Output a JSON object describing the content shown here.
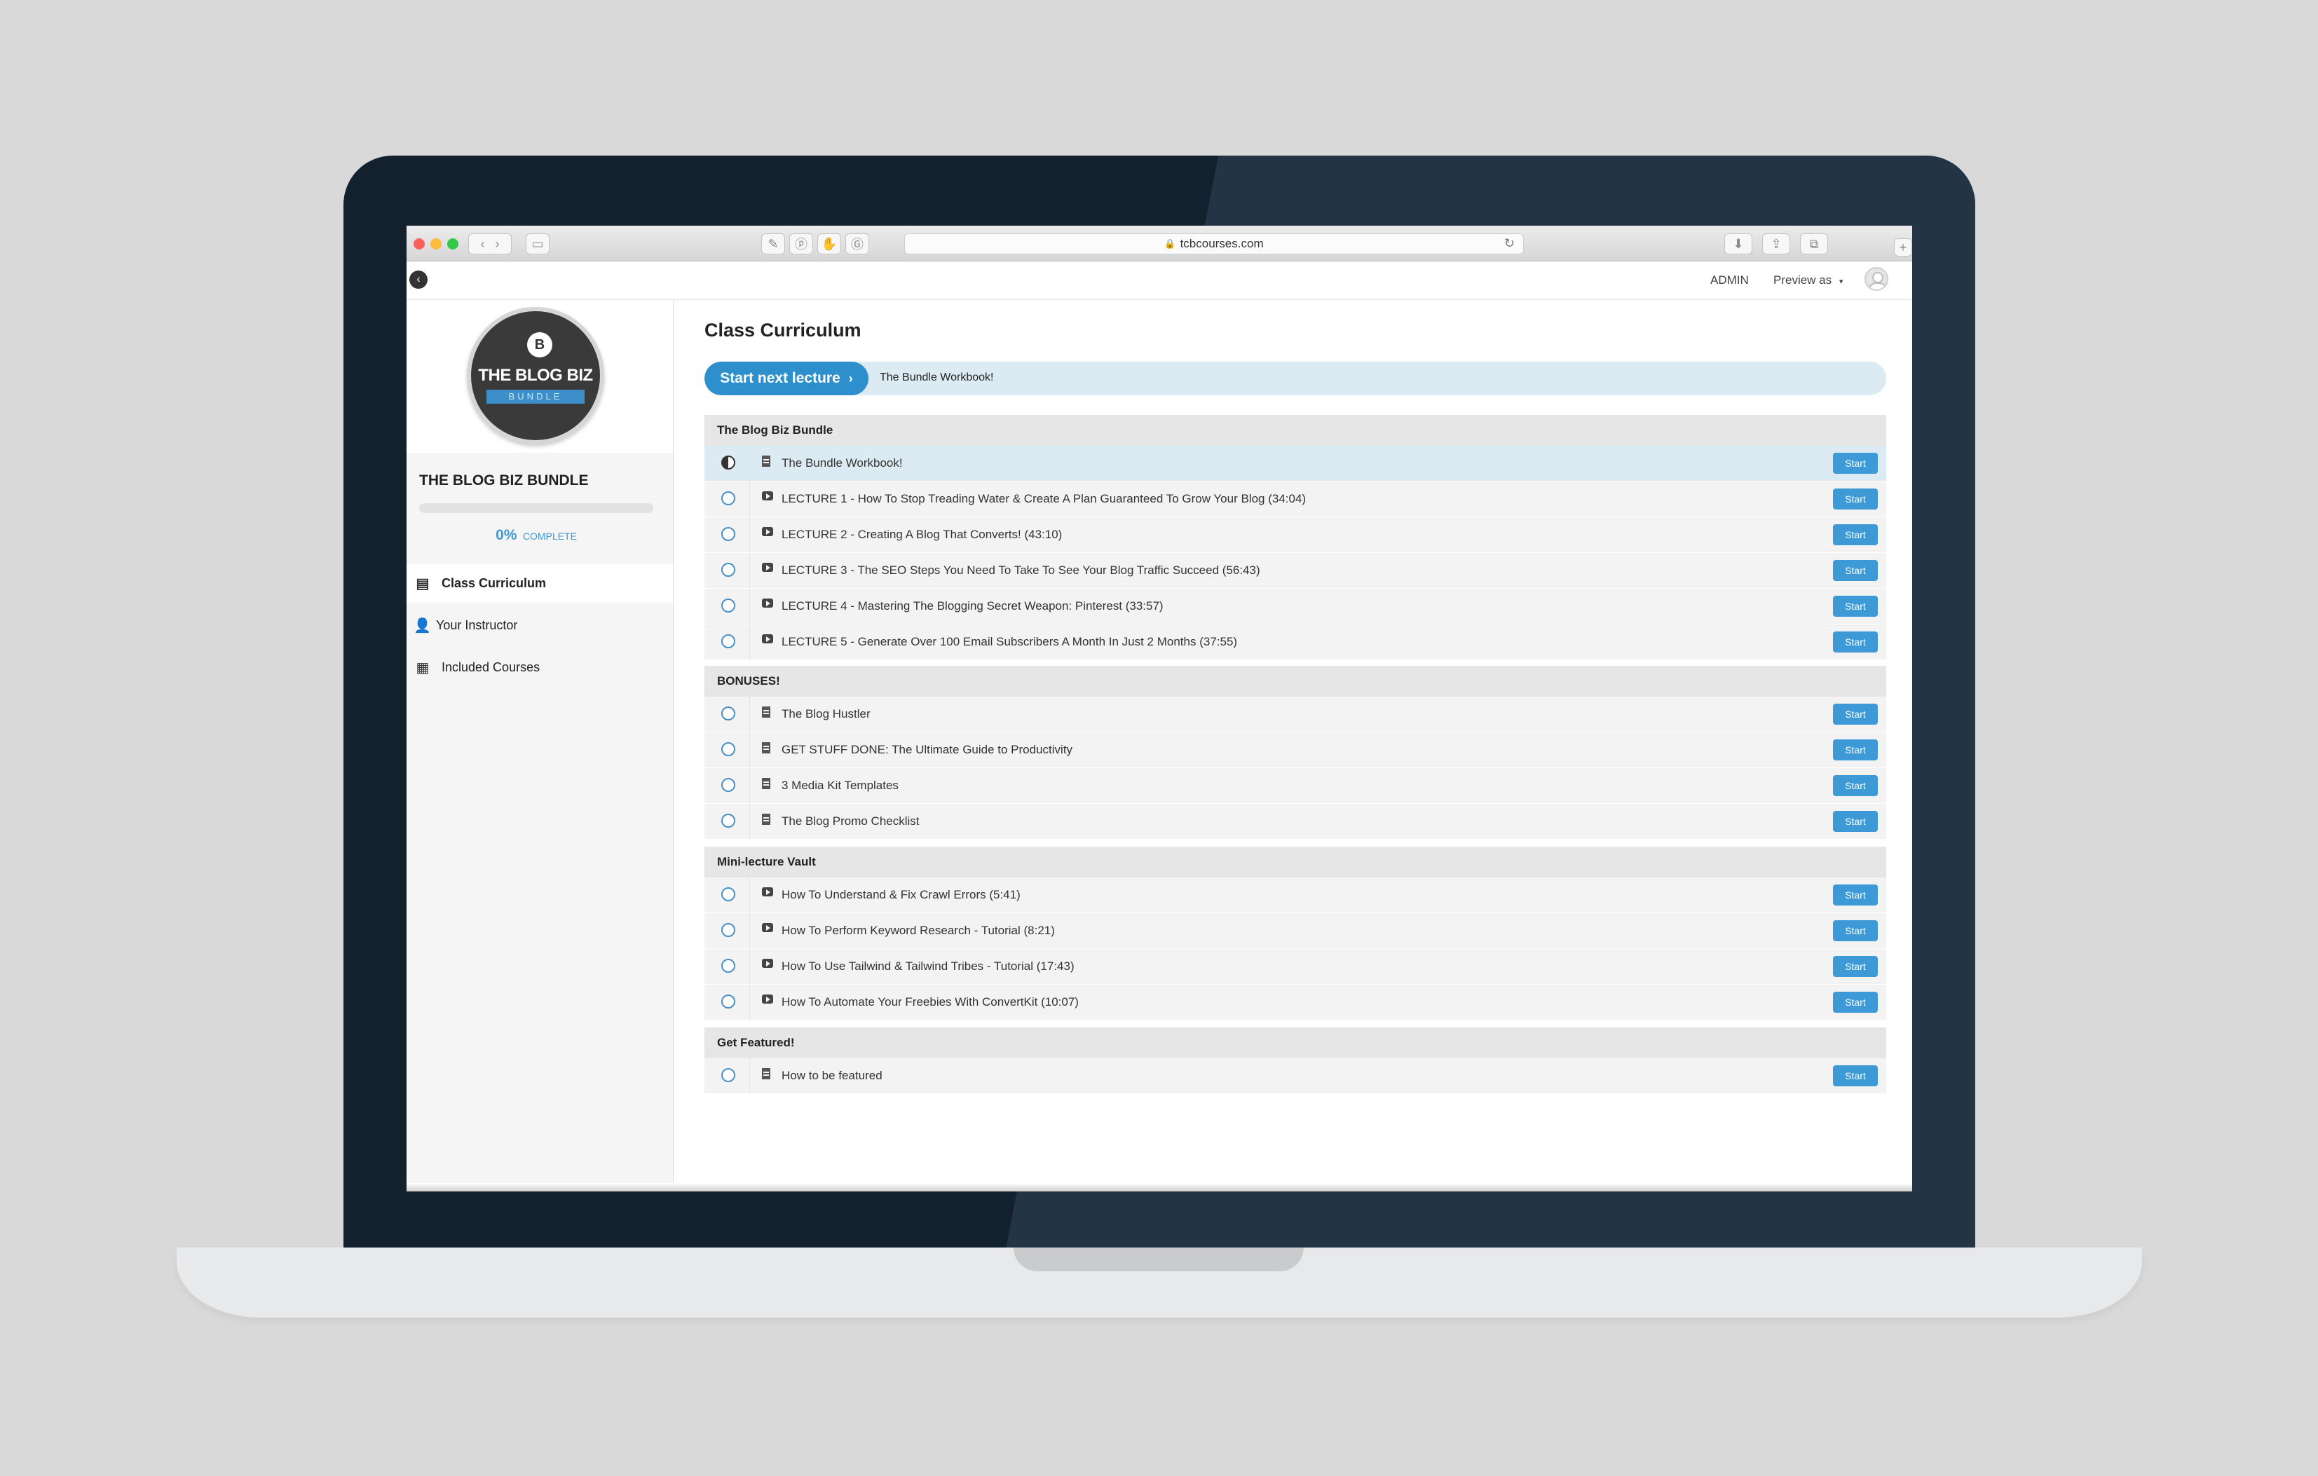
{
  "browser": {
    "url": "tcbcourses.com"
  },
  "topbar": {
    "admin_label": "ADMIN",
    "preview_label": "Preview as"
  },
  "sidebar": {
    "logo": {
      "letter": "B",
      "title": "THE BLOG BIZ",
      "ribbon": "BUNDLE"
    },
    "course_title": "THE BLOG BIZ BUNDLE",
    "progress": {
      "percent": 0,
      "percent_text": "0%",
      "label": "COMPLETE"
    },
    "nav": [
      {
        "label": "Class Curriculum",
        "icon": "curriculum-icon",
        "active": true
      },
      {
        "label": "Your Instructor",
        "icon": "user-icon",
        "active": false
      },
      {
        "label": "Included Courses",
        "icon": "grid-icon",
        "active": false
      }
    ]
  },
  "main": {
    "page_title": "Class Curriculum",
    "next": {
      "button_label": "Start next lecture",
      "lecture_name": "The Bundle Workbook!"
    },
    "start_label": "Start",
    "sections": [
      {
        "title": "The Blog Biz Bundle",
        "items": [
          {
            "title": "The Bundle Workbook!",
            "type": "doc",
            "status": "in-progress"
          },
          {
            "title": "LECTURE 1 - How To Stop Treading Water & Create A Plan Guaranteed To Grow Your Blog (34:04)",
            "type": "video",
            "status": "none"
          },
          {
            "title": "LECTURE 2 - Creating A Blog That Converts! (43:10)",
            "type": "video",
            "status": "none"
          },
          {
            "title": "LECTURE 3 - The SEO Steps You Need To Take To See Your Blog Traffic Succeed (56:43)",
            "type": "video",
            "status": "none"
          },
          {
            "title": "LECTURE 4 - Mastering The Blogging Secret Weapon: Pinterest (33:57)",
            "type": "video",
            "status": "none"
          },
          {
            "title": "LECTURE 5 - Generate Over 100 Email Subscribers A Month In Just 2 Months (37:55)",
            "type": "video",
            "status": "none"
          }
        ]
      },
      {
        "title": "BONUSES!",
        "items": [
          {
            "title": "The Blog Hustler",
            "type": "doc",
            "status": "none"
          },
          {
            "title": "GET STUFF DONE: The Ultimate Guide to Productivity",
            "type": "doc",
            "status": "none"
          },
          {
            "title": "3 Media Kit Templates",
            "type": "doc",
            "status": "none"
          },
          {
            "title": "The Blog Promo Checklist",
            "type": "doc",
            "status": "none"
          }
        ]
      },
      {
        "title": "Mini-lecture Vault",
        "items": [
          {
            "title": "How To Understand & Fix Crawl Errors (5:41)",
            "type": "video",
            "status": "none"
          },
          {
            "title": "How To Perform Keyword Research - Tutorial (8:21)",
            "type": "video",
            "status": "none"
          },
          {
            "title": "How To Use Tailwind & Tailwind Tribes - Tutorial (17:43)",
            "type": "video",
            "status": "none"
          },
          {
            "title": "How To Automate Your Freebies With ConvertKit (10:07)",
            "type": "video",
            "status": "none"
          }
        ]
      },
      {
        "title": "Get Featured!",
        "items": [
          {
            "title": "How to be featured",
            "type": "doc",
            "status": "none"
          }
        ]
      }
    ]
  },
  "colors": {
    "accent": "#3d9ad6",
    "accent_dark": "#2d8fcc",
    "current_row": "#dcebf3",
    "laptop_bezel": "#13212f"
  }
}
